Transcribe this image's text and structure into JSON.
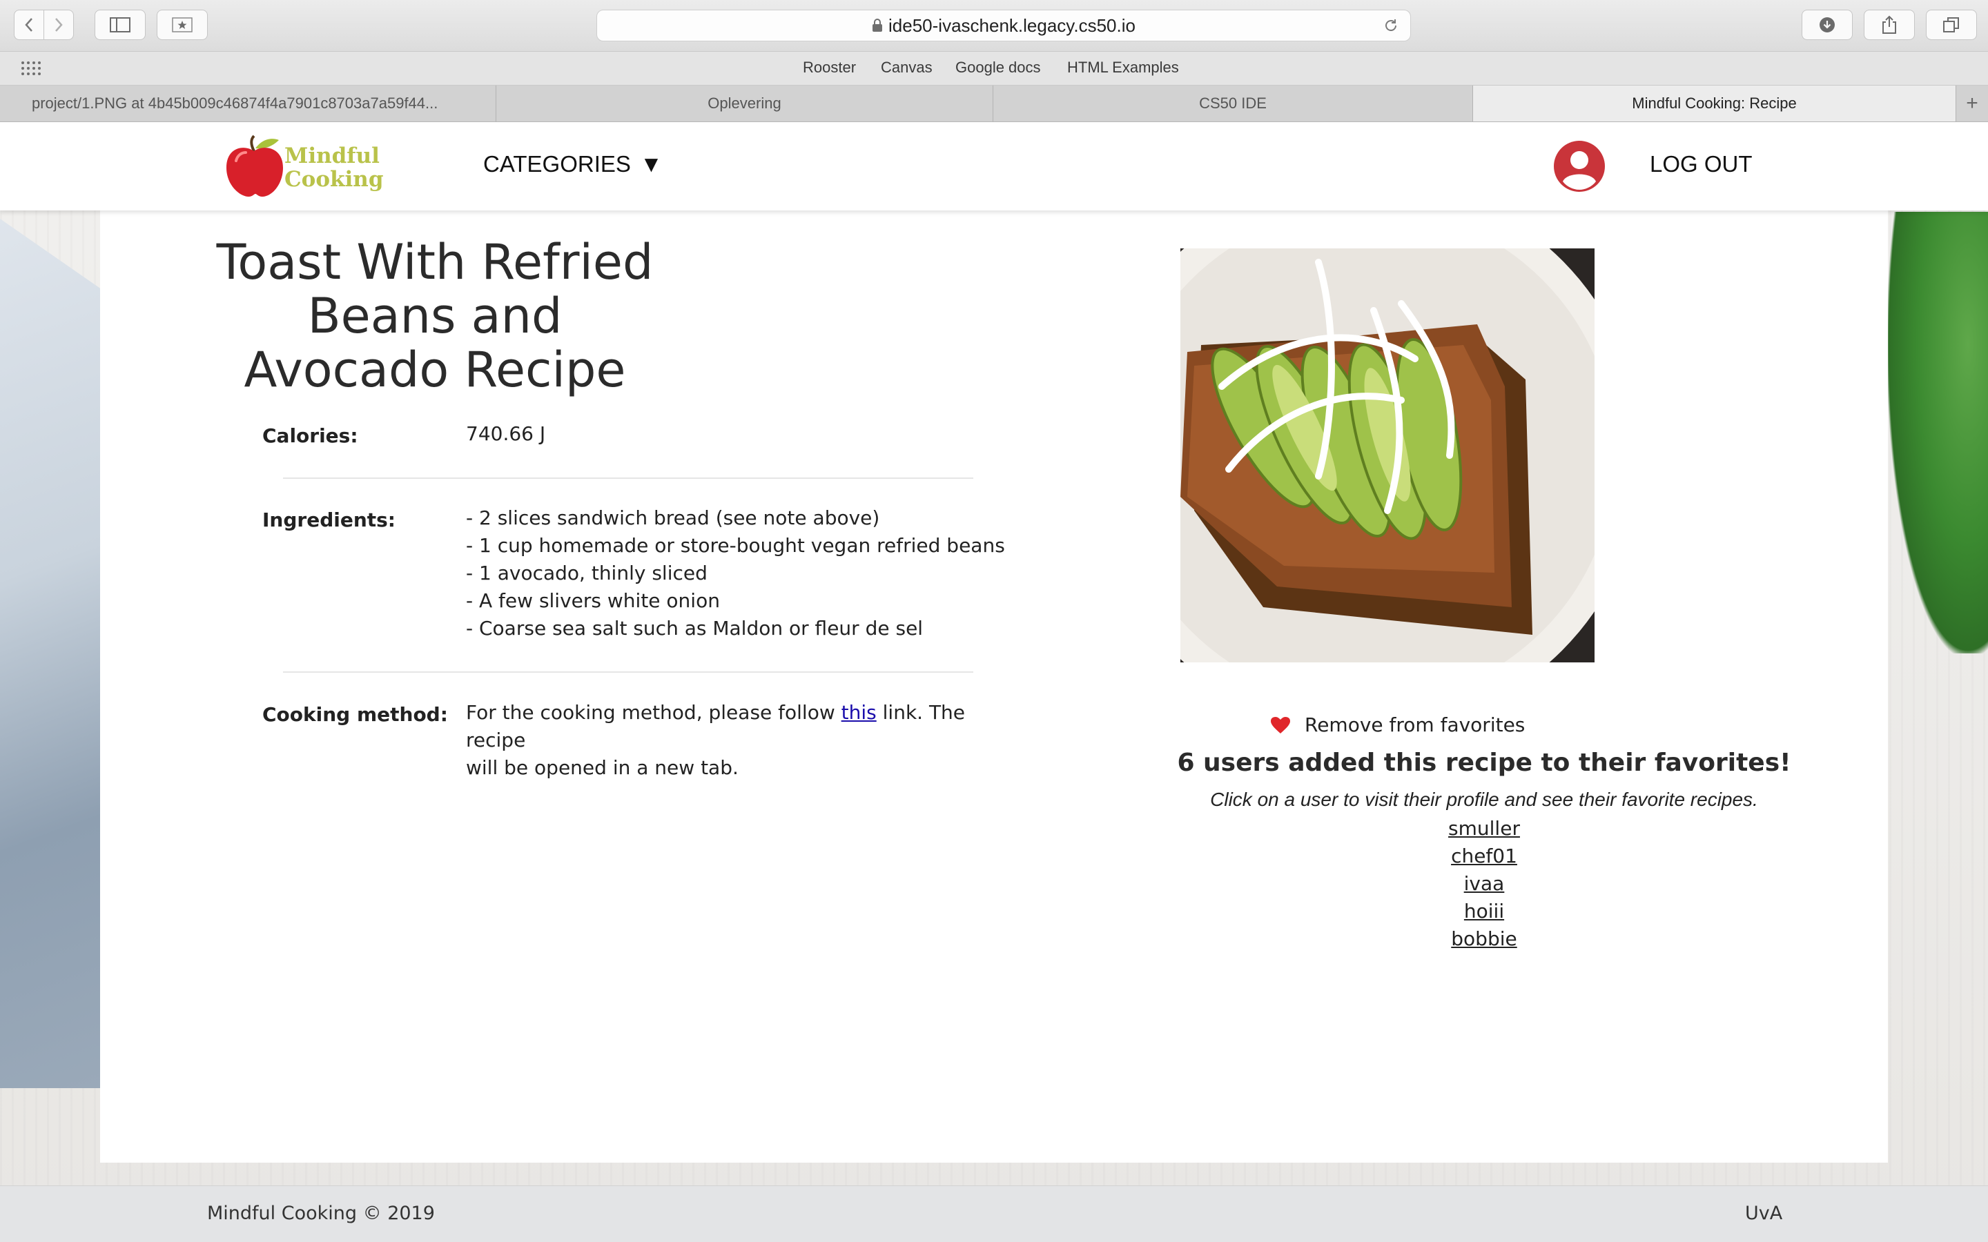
{
  "browser": {
    "url": "ide50-ivaschenk.legacy.cs50.io",
    "bookmarks": [
      "Rooster",
      "Canvas",
      "Google docs",
      "HTML Examples"
    ],
    "tabs": [
      {
        "label": "project/1.PNG at 4b45b009c46874f4a7901c8703a7a59f44...",
        "active": false
      },
      {
        "label": "Oplevering",
        "active": false
      },
      {
        "label": "CS50 IDE",
        "active": false
      },
      {
        "label": "Mindful Cooking: Recipe",
        "active": true
      }
    ],
    "new_tab": "+"
  },
  "site": {
    "logo": {
      "line1": "Mindful",
      "line2": "Cooking"
    },
    "nav": {
      "categories": "CATEGORIES",
      "categories_arrow": "▼",
      "logout": "LOG OUT"
    },
    "colors": {
      "brand_green": "#b9c24a",
      "apple_red": "#d8202a",
      "avatar_red": "#c9343a"
    }
  },
  "recipe": {
    "title_line1": "Toast With Refried Beans and",
    "title_line2": "Avocado Recipe",
    "calories_label": "Calories:",
    "calories_value": "740.66 J",
    "ingredients_label": "Ingredients:",
    "ingredients": [
      "- 2 slices sandwich bread (see note above)",
      "- 1 cup homemade or store-bought vegan refried beans",
      "- 1 avocado, thinly sliced",
      "- A few slivers white onion",
      "- Coarse sea salt such as Maldon or fleur de sel"
    ],
    "method_label": "Cooking method:",
    "method_before": "For the cooking method, please follow ",
    "method_link": "this",
    "method_after": " link. The recipe",
    "method_line2": "will be opened in a new tab."
  },
  "favorites": {
    "heart_icon": "heart-icon",
    "remove_label": "Remove from favorites",
    "count_heading": "6 users added this recipe to their favorites!",
    "hint": "Click on a user to visit their profile and see their favorite recipes.",
    "users": [
      "smuller",
      "chef01",
      "ivaa",
      "hoiii",
      "bobbie"
    ]
  },
  "footer": {
    "left": "Mindful Cooking © 2019",
    "right": "UvA"
  }
}
